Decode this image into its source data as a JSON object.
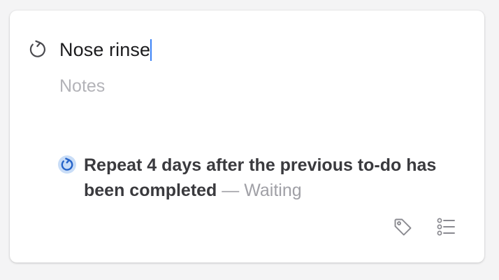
{
  "todo": {
    "title": "Nose rinse",
    "notes_placeholder": "Notes",
    "repeat": {
      "description": "Repeat 4 days after the previous to-do has been completed",
      "status": " — Waiting"
    }
  },
  "icons": {
    "repeat": "repeat-arrow-icon",
    "tag": "tag-icon",
    "checklist": "checklist-icon"
  },
  "colors": {
    "accent": "#3b82f6",
    "badge_bg": "#c9ddf7",
    "badge_fg": "#2563c9"
  }
}
